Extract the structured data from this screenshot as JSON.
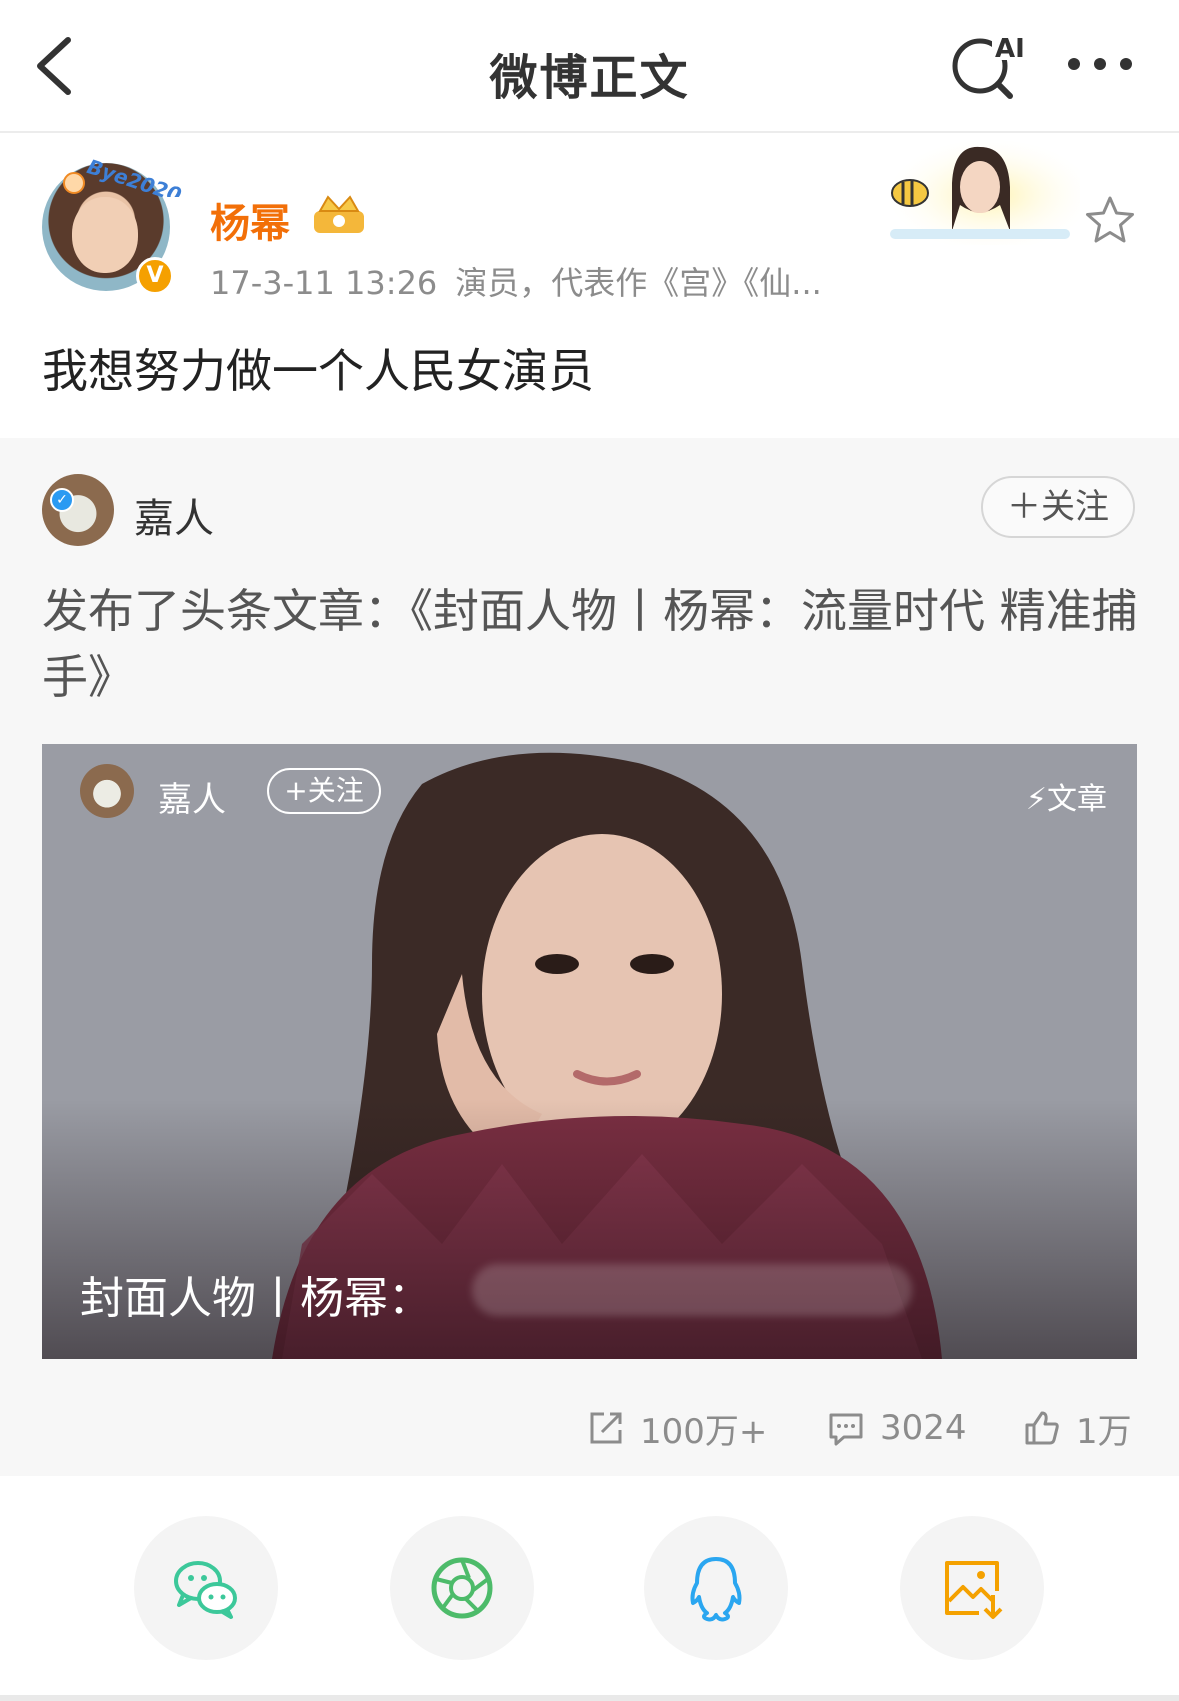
{
  "nav": {
    "title": "微博正文",
    "ai_label": "AI"
  },
  "post": {
    "author": "杨幂",
    "avatar_tag": "Bye2020",
    "vip_badge": "V",
    "time": "17-3-11 13:26",
    "source": "演员，代表作《宫》《仙...",
    "text": "我想努力做一个人民女演员"
  },
  "repost": {
    "author": "嘉人",
    "follow_label": "＋关注",
    "text": "发布了头条文章：《封面人物丨杨幂：流量时代 精准捕手》",
    "card": {
      "author": "嘉人",
      "follow_label": "+关注",
      "tag": "文章",
      "title": "封面人物丨杨幂："
    },
    "stats": {
      "reposts": "100万+",
      "comments": "3024",
      "likes": "1万"
    }
  },
  "share": {
    "items": [
      "wechat-icon",
      "moments-icon",
      "qq-icon",
      "save-image-icon"
    ],
    "colors": {
      "wechat": "#3cc89a",
      "moments": "#4dbb6a",
      "qq": "#2aa6f0",
      "save": "#f4a100"
    }
  },
  "colors": {
    "author_name": "#f26f08",
    "muted": "#8c8c8c"
  }
}
